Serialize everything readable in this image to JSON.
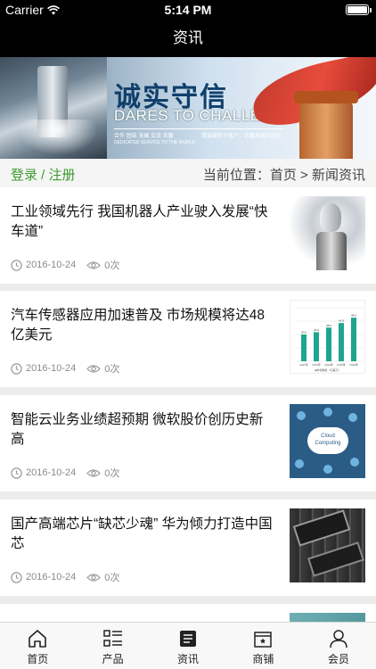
{
  "status": {
    "carrier": "Carrier",
    "time": "5:14 PM"
  },
  "nav": {
    "title": "资讯"
  },
  "banner": {
    "cn_text": "诚实守信",
    "en_text": "DARES TO CHALLENGE",
    "small_left": "合作 团结 发展 交流 共赢",
    "small_right": "竭诚服务于客户，共赢发展的团队",
    "small_bottom": "DEDICATED SERVICE TO THE WORLD"
  },
  "breadcrumb": {
    "login": "登录 / 注册",
    "location": "当前位置：首页 > 新闻资讯"
  },
  "news": [
    {
      "title": "工业领域先行 我国机器人产业驶入发展“快车道”",
      "date": "2016-10-24",
      "views": "0次",
      "thumb": "robot-image"
    },
    {
      "title": "汽车传感器应用加速普及 市场规模将达48亿美元",
      "date": "2016-10-24",
      "views": "0次",
      "thumb": "chart-image"
    },
    {
      "title": "智能云业务业绩超预期 微软股价创历史新高",
      "date": "2016-10-24",
      "views": "0次",
      "thumb": "cloud-computing-image",
      "thumb_text": "Cloud Computing"
    },
    {
      "title": "国产高端芯片“缺芯少魂” 华为倾力打造中国芯",
      "date": "2016-10-24",
      "views": "0次",
      "thumb": "chip-image"
    },
    {
      "title": "",
      "date": "",
      "views": "",
      "thumb": "teal-image"
    }
  ],
  "chart_thumb": {
    "values": [
      35,
      38,
      44,
      50,
      57
    ],
    "labels": [
      "2012年",
      "2013年",
      "2014年",
      "2015年",
      "2016年"
    ],
    "data_labels": [
      "30.6",
      "31.9",
      "38.3",
      "41.8",
      "48.4"
    ],
    "legend": "■市场规模（亿美元）",
    "color": "#1fa58f"
  },
  "tabs": [
    {
      "label": "首页",
      "icon": "home-icon"
    },
    {
      "label": "产品",
      "icon": "product-list-icon"
    },
    {
      "label": "资讯",
      "icon": "news-icon"
    },
    {
      "label": "商铺",
      "icon": "shop-icon"
    },
    {
      "label": "会员",
      "icon": "member-icon"
    }
  ],
  "colors": {
    "accent_green": "#3e9b2e",
    "nav_bg": "#000000"
  }
}
